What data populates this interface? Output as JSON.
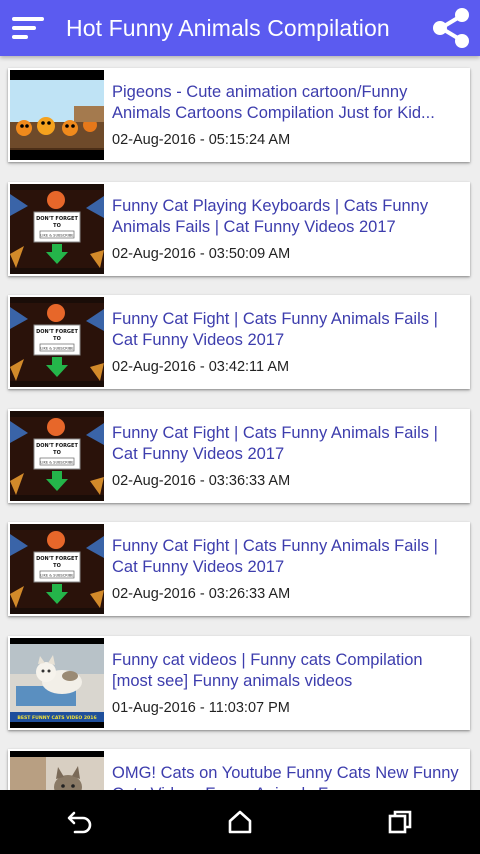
{
  "app": {
    "title": "Hot Funny Animals Compilation",
    "accent_color": "#5b5bf0",
    "menu_icon": "hamburger-menu-icon",
    "share_icon": "share-icon"
  },
  "videos": [
    {
      "title": "Pigeons - Cute animation cartoon/Funny Animals Cartoons Compilation Just for Kid...",
      "date": "02-Aug-2016 - 05:15:24 AM",
      "thumb": "cartoon"
    },
    {
      "title": "Funny Cat Playing Keyboards | Cats Funny Animals Fails | Cat Funny Videos 2017",
      "date": "02-Aug-2016 - 03:50:09 AM",
      "thumb": "reminder"
    },
    {
      "title": "Funny Cat Fight | Cats Funny Animals Fails | Cat Funny Videos 2017",
      "date": "02-Aug-2016 - 03:42:11 AM",
      "thumb": "reminder"
    },
    {
      "title": "Funny Cat Fight | Cats Funny Animals Fails | Cat Funny Videos 2017",
      "date": "02-Aug-2016 - 03:36:33 AM",
      "thumb": "reminder"
    },
    {
      "title": "Funny Cat Fight | Cats Funny Animals Fails | Cat Funny Videos 2017",
      "date": "02-Aug-2016 - 03:26:33 AM",
      "thumb": "reminder"
    },
    {
      "title": "Funny cat videos | Funny cats Compilation [most see] Funny animals videos",
      "date": "01-Aug-2016 - 11:03:07 PM",
      "thumb": "cat"
    },
    {
      "title": "OMG! Cats on Youtube   Funny Cats   New Funny Cats Videos   Funny Animals   F...",
      "date": "",
      "thumb": "cat2"
    }
  ],
  "thumb_text": {
    "reminder_line1": "DON'T FORGET",
    "reminder_line2": "TO",
    "reminder_line3": "LIKE & SUBSCRIBE",
    "cat_banner": "BEST FUNNY CATS VIDEO 2016"
  },
  "navbar": {
    "back_icon": "back-icon",
    "home_icon": "home-icon",
    "recents_icon": "recents-icon"
  }
}
